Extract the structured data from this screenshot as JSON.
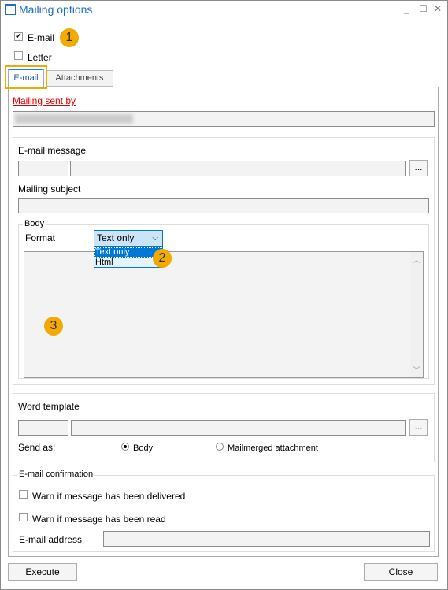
{
  "window": {
    "title": "Mailing options",
    "minimize": "_",
    "maximize": "☐",
    "close": "✕"
  },
  "options": {
    "email_label": "E-mail",
    "email_checked": true,
    "letter_label": "Letter",
    "letter_checked": false
  },
  "badges": [
    "1",
    "2",
    "3"
  ],
  "tabs": [
    {
      "label": "E-mail",
      "active": true
    },
    {
      "label": "Attachments",
      "active": false
    }
  ],
  "email_tab": {
    "mailing_sent_by": "Mailing sent by",
    "email_message_label": "E-mail message",
    "browse": "...",
    "mailing_subject_label": "Mailing subject",
    "body_legend": "Body",
    "format_label": "Format",
    "format_value": "Text only",
    "format_options": [
      "Text only",
      "Html"
    ],
    "word_template_label": "Word template",
    "send_as_label": "Send as:",
    "send_as_options": [
      {
        "label": "Body",
        "selected": true
      },
      {
        "label": "Mailmerged attachment",
        "selected": false
      }
    ],
    "confirmation_legend": "E-mail confirmation",
    "warn_delivered": "Warn if message has been delivered",
    "warn_read": "Warn if message has been read",
    "email_address_label": "E-mail address"
  },
  "footer": {
    "execute": "Execute",
    "close": "Close"
  },
  "colors": {
    "accent": "#0078d7",
    "highlight": "#f2a900",
    "required": "#e00000"
  }
}
